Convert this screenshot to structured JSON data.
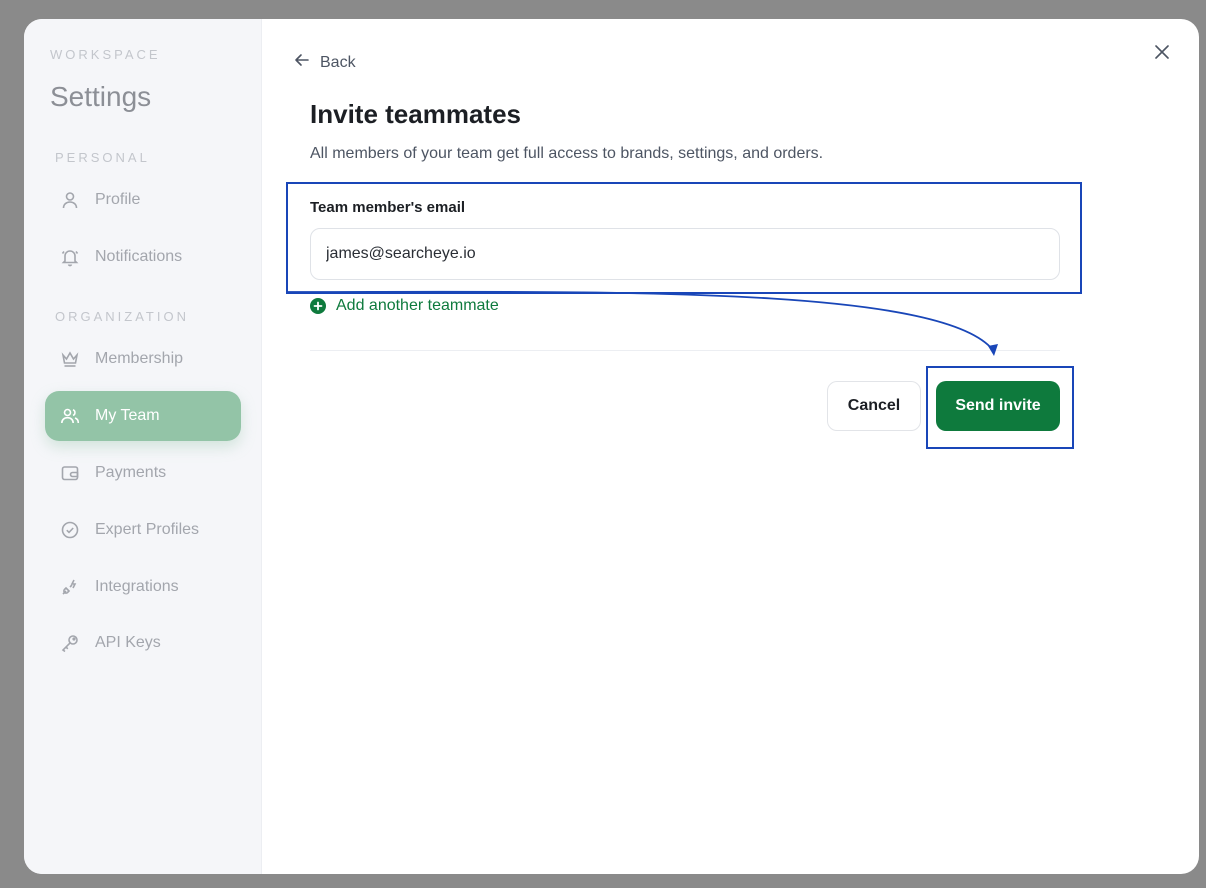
{
  "sidebar": {
    "workspace_label": "WORKSPACE",
    "title": "Settings",
    "personal_label": "PERSONAL",
    "organization_label": "ORGANIZATION",
    "items": [
      {
        "label": "Profile",
        "icon": "user-icon"
      },
      {
        "label": "Notifications",
        "icon": "bell-icon"
      },
      {
        "label": "Membership",
        "icon": "crown-icon"
      },
      {
        "label": "My Team",
        "icon": "users-icon",
        "active": true
      },
      {
        "label": "Payments",
        "icon": "wallet-icon"
      },
      {
        "label": "Expert Profiles",
        "icon": "badge-check-icon"
      },
      {
        "label": "Integrations",
        "icon": "plug-icon"
      },
      {
        "label": "API Keys",
        "icon": "key-icon"
      }
    ]
  },
  "main": {
    "back_label": "Back",
    "title": "Invite teammates",
    "subtitle": "All members of your team get full access to brands, settings, and orders.",
    "email_label": "Team member's email",
    "email_value": "james@searcheye.io",
    "add_another_label": "Add another teammate",
    "cancel_label": "Cancel",
    "send_label": "Send invite"
  },
  "colors": {
    "accent_green": "#0e7a3d",
    "active_nav": "#93c4a7",
    "annotation_blue": "#1946b8"
  }
}
